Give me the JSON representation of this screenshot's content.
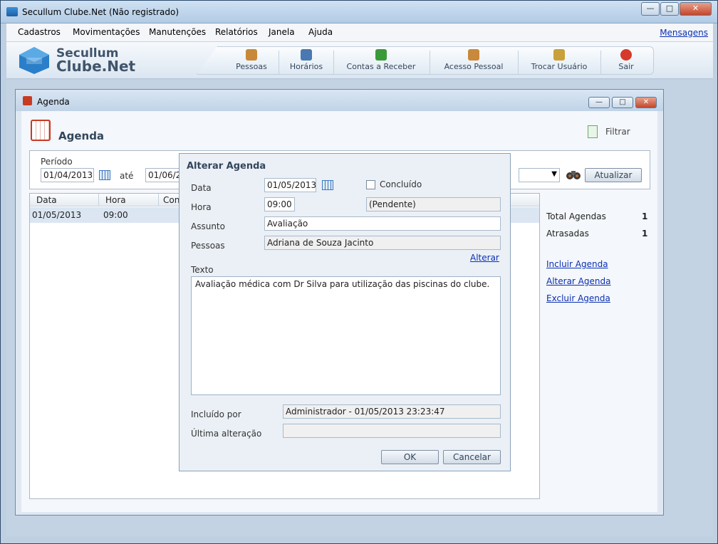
{
  "window": {
    "title": "Secullum Clube.Net (Não registrado)",
    "min": "—",
    "max": "□",
    "close": "✕"
  },
  "menu": {
    "items": [
      "Cadastros",
      "Movimentações",
      "Manutenções",
      "Relatórios",
      "Janela",
      "Ajuda"
    ],
    "messages_link": "Mensagens"
  },
  "logo": {
    "line1": "Secullum",
    "line2": "Clube.Net"
  },
  "toolbar": {
    "buttons": [
      {
        "label": "Pessoas",
        "icon": "people-icon",
        "color": "#c9893a"
      },
      {
        "label": "Horários",
        "icon": "schedule-icon",
        "color": "#4a78b0"
      },
      {
        "label": "Contas a Receber",
        "icon": "receivables-icon",
        "color": "#3a9a3a"
      },
      {
        "label": "Acesso Pessoal",
        "icon": "access-icon",
        "color": "#c9893a"
      },
      {
        "label": "Trocar Usuário",
        "icon": "switch-user-icon",
        "color": "#c9a03a"
      },
      {
        "label": "Sair",
        "icon": "power-icon",
        "color": "#d63a2a"
      }
    ]
  },
  "agenda_window": {
    "title": "Agenda",
    "heading": "Agenda",
    "filter_label": "Filtrar",
    "period_label": "Período",
    "date_from": "01/04/2013",
    "between": "até",
    "date_to": "01/06/2",
    "refresh_button": "Atualizar",
    "grid": {
      "columns": [
        "Data",
        "Hora",
        "Con"
      ],
      "rows": [
        {
          "data": "01/05/2013",
          "hora": "09:00"
        }
      ]
    },
    "stats": [
      {
        "label": "Total Agendas",
        "value": "1"
      },
      {
        "label": "Atrasadas",
        "value": "1"
      }
    ],
    "actions": [
      "Incluir Agenda",
      "Alterar Agenda",
      "Excluir Agenda"
    ]
  },
  "dialog": {
    "title": "Alterar Agenda",
    "data_label": "Data",
    "data_value": "01/05/2013",
    "concluido_label": "Concluído",
    "hora_label": "Hora",
    "hora_value": "09:00",
    "status_value": "(Pendente)",
    "assunto_label": "Assunto",
    "assunto_value": "Avaliação",
    "pessoas_label": "Pessoas",
    "pessoas_value": "Adriana de Souza Jacinto",
    "alterar_link": "Alterar",
    "texto_label": "Texto",
    "texto_value": "Avaliação médica com Dr Silva para utilização das piscinas do clube.",
    "incluido_label": "Incluído por",
    "incluido_value": "Administrador - 01/05/2013 23:23:47",
    "ultima_label": "Última alteração",
    "ultima_value": "",
    "ok_button": "OK",
    "cancel_button": "Cancelar"
  }
}
